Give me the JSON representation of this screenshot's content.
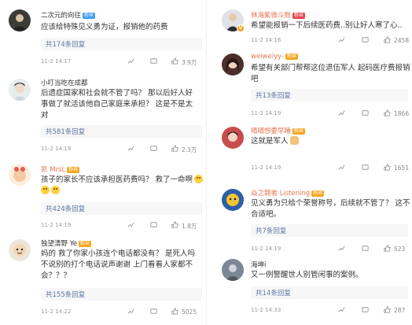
{
  "left": [
    {
      "username": "二次元的向往",
      "badge": "粉丝",
      "text": "应该给特殊见义勇为证，报销他的药费",
      "replies": "共174条回复",
      "time": "11-2 14:17",
      "likes": "3.9万"
    },
    {
      "username": "小叮当吃在成都",
      "badge": "",
      "text_lines": [
        "后遗症国家和社会就不管了吗？ 那以后好人好",
        "事做了就活该他自己家庭来承担？ 这是不是太",
        "对"
      ],
      "replies": "共581条回复",
      "time": "11-2 14:19",
      "likes": "2.3万"
    },
    {
      "username": "凯 MrsL",
      "badge": "粉丝",
      "text_lines": [
        "孩子的家长不应该承担医药费吗？ 救了一命啊",
        ""
      ],
      "replies": "共424条回复",
      "time": "11-2 14:19",
      "likes": "1.8万"
    },
    {
      "username": "独望清野 Ye",
      "badge": "粉丝",
      "text_lines": [
        "妈的  救了你家小孩连个电话都没有？ 是死人吗",
        "不说别的打个电话说声谢谢 上门看看人家都不",
        "会？？？"
      ],
      "replies": "共155条回复",
      "time": "11-2 14:22",
      "likes": "5025"
    }
  ],
  "right": [
    {
      "username": "林海紫微斗数",
      "badge": "粉丝",
      "text": "希望能报销一下后续医药费..别让好人寒了心..",
      "time": "11-2 14:16",
      "likes": "2458"
    },
    {
      "username": "weiweiyy-",
      "badge": "粉丝",
      "text_lines": [
        "希望有关部门帮帮这位退伍军人 起码医疗费报销",
        "吧"
      ],
      "replies": "共13条回复",
      "time": "11-2 14:19",
      "likes": "1866"
    },
    {
      "username": "晴晴想要早睡",
      "badge": "粉丝",
      "text": "这就是军人",
      "time": "11-2 14:19",
      "likes": "1651"
    },
    {
      "username": "焱之翱者 Listening",
      "badge": "粉丝",
      "text_lines": [
        "见义勇为只给个荣誉称号，后续就不管了？ 这不",
        "合适吧。"
      ],
      "replies": "共7条回复",
      "time": "11-2 14:19",
      "likes": "523"
    },
    {
      "username": "海坤i",
      "badge": "",
      "text": "又一例警醒世人别管闲事的案例。",
      "replies": "共14条回复",
      "time": "11-2 14:33",
      "likes": "287"
    }
  ],
  "icons": [
    "share-icon",
    "comment-icon",
    "like-icon"
  ],
  "colors": {
    "username": "#eb7350",
    "link": "#5b76a6",
    "meta": "#999999"
  }
}
